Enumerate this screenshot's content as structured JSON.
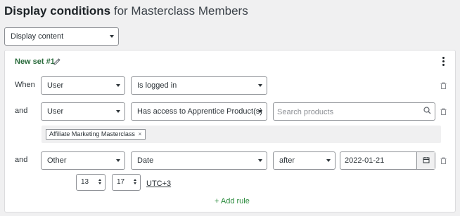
{
  "header": {
    "title_bold": "Display conditions",
    "title_rest": "for Masterclass Members"
  },
  "mode_select": {
    "value": "Display content"
  },
  "set": {
    "name": "New set #1"
  },
  "rules": [
    {
      "connector": "When",
      "subject": "User",
      "condition": "Is logged in"
    },
    {
      "connector": "and",
      "subject": "User",
      "condition": "Has access to Apprentice Product(s)",
      "search_placeholder": "Search products",
      "tags": [
        {
          "label": "Affiliate Marketing Masterclass",
          "remove": "×"
        }
      ]
    },
    {
      "connector": "and",
      "subject": "Other",
      "condition": "Date",
      "operator": "after",
      "date": "2022-01-21",
      "hour": "13",
      "minute": "17",
      "timezone": "UTC+3"
    }
  ],
  "add_rule_label": "+ Add rule",
  "colors": {
    "set_name": "#2a6b3c",
    "add_rule": "#2a8a3c",
    "border": "#8c8f94",
    "background": "#f0f0f1"
  }
}
